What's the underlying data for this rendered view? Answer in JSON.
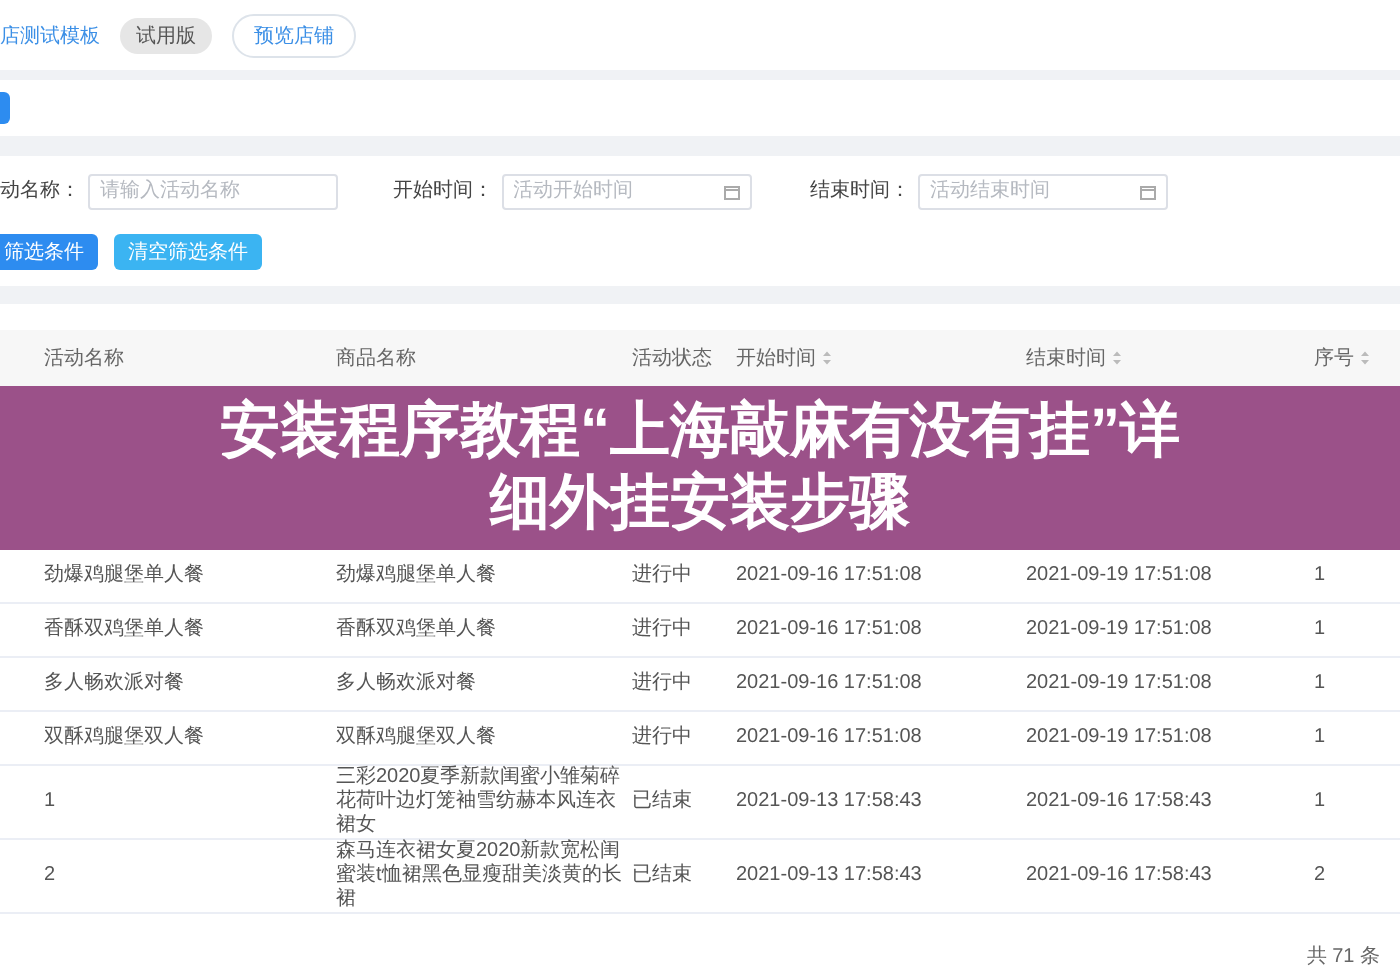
{
  "top_bar": {
    "template_link": "店测试模板",
    "trial_tag": "试用版",
    "preview_button": "预览店铺"
  },
  "filters": {
    "fields": [
      {
        "label": "动名称：",
        "placeholder": "请输入活动名称",
        "kind": "text"
      },
      {
        "label": "开始时间：",
        "placeholder": "活动开始时间",
        "kind": "date"
      },
      {
        "label": "结束时间：",
        "placeholder": "活动结束时间",
        "kind": "date"
      }
    ],
    "buttons": [
      {
        "label": "筛选条件",
        "kind": "primary"
      },
      {
        "label": "清空筛选条件",
        "kind": "secondary"
      }
    ]
  },
  "table": {
    "columns": [
      {
        "label": "活动名称",
        "sortable": false
      },
      {
        "label": "商品名称",
        "sortable": false
      },
      {
        "label": "活动状态",
        "sortable": false
      },
      {
        "label": "开始时间",
        "sortable": true
      },
      {
        "label": "结束时间",
        "sortable": true
      },
      {
        "label": "序号",
        "sortable": true
      }
    ],
    "rows": [
      [
        "劲爆鸡腿堡单人餐",
        "劲爆鸡腿堡单人餐",
        "进行中",
        "2021-09-16 17:51:08",
        "2021-09-19 17:51:08",
        "1"
      ],
      [
        "香酥双鸡堡单人餐",
        "香酥双鸡堡单人餐",
        "进行中",
        "2021-09-16 17:51:08",
        "2021-09-19 17:51:08",
        "1"
      ],
      [
        "多人畅欢派对餐",
        "多人畅欢派对餐",
        "进行中",
        "2021-09-16 17:51:08",
        "2021-09-19 17:51:08",
        "1"
      ],
      [
        "双酥鸡腿堡双人餐",
        "双酥鸡腿堡双人餐",
        "进行中",
        "2021-09-16 17:51:08",
        "2021-09-19 17:51:08",
        "1"
      ],
      [
        "1",
        "三彩2020夏季新款闺蜜小雏菊碎花荷叶边灯笼袖雪纺赫本风连衣裙女",
        "已结束",
        "2021-09-13 17:58:43",
        "2021-09-16 17:58:43",
        "1"
      ],
      [
        "2",
        "森马连衣裙女夏2020新款宽松闺蜜装t恤裙黑色显瘦甜美淡黄的长裙",
        "已结束",
        "2021-09-13 17:58:43",
        "2021-09-16 17:58:43",
        "2"
      ]
    ],
    "total": "共 71 条"
  },
  "banner": {
    "lines": [
      "安装程序教程“上海敲麻有没有挂”详",
      "细外挂安装步骤"
    ]
  }
}
